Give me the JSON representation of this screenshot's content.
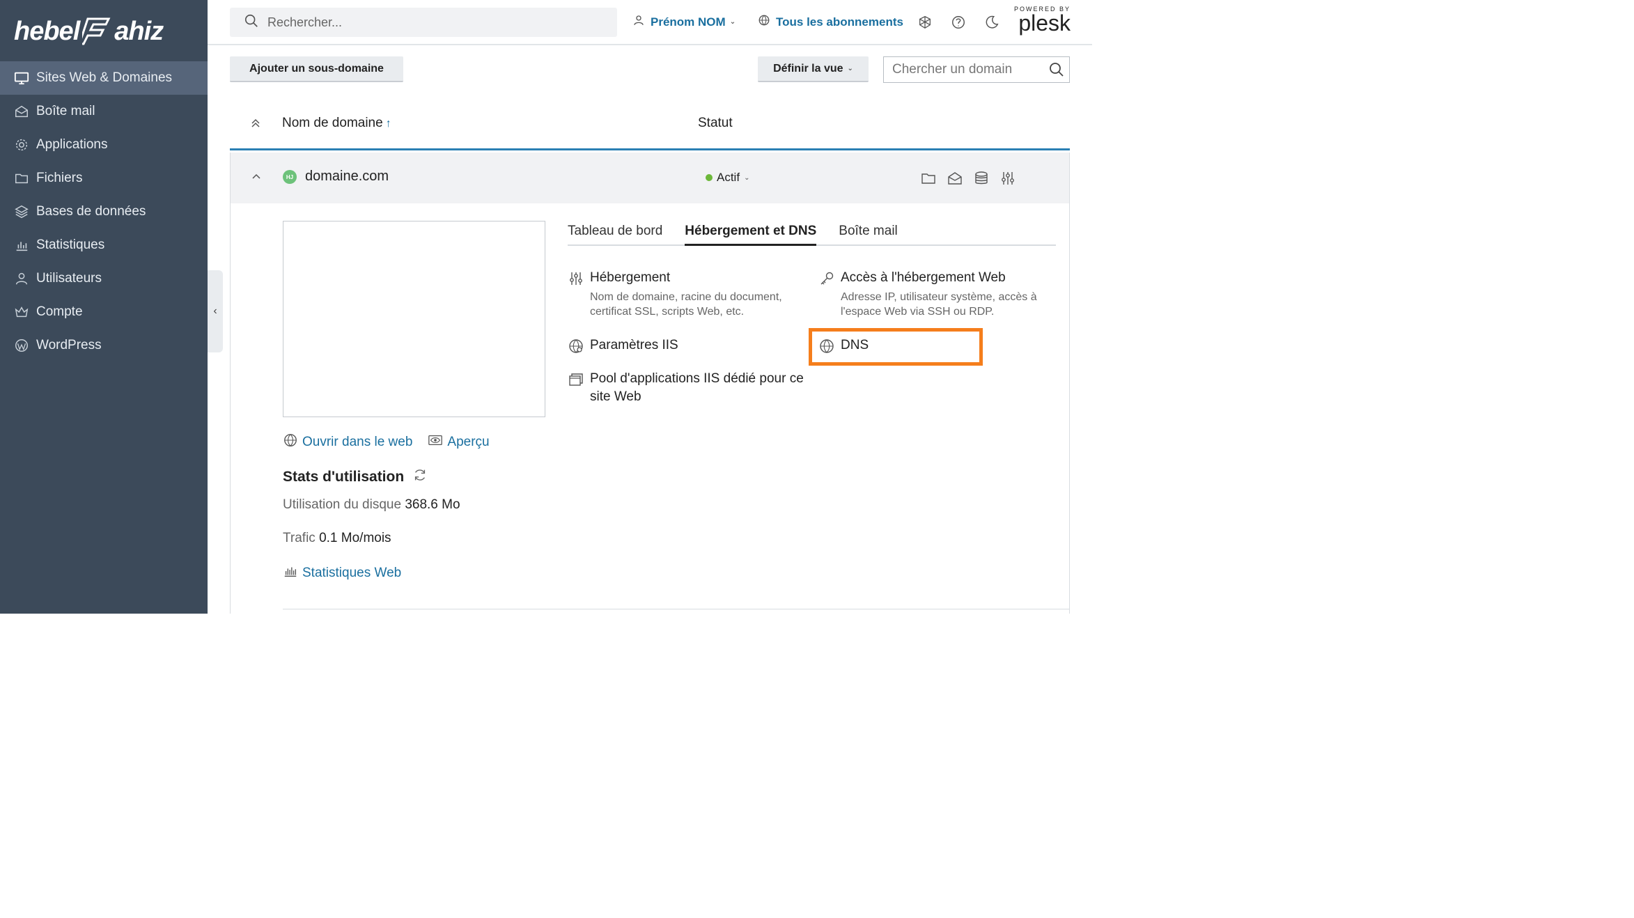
{
  "brand": {
    "logo_left": "hebel",
    "logo_right": "ahiz"
  },
  "sidebar": {
    "items": [
      {
        "label": "Sites Web & Domaines",
        "icon": "monitor-icon",
        "active": true
      },
      {
        "label": "Boîte mail",
        "icon": "mail-icon",
        "active": false
      },
      {
        "label": "Applications",
        "icon": "gear-icon",
        "active": false
      },
      {
        "label": "Fichiers",
        "icon": "folder-icon",
        "active": false
      },
      {
        "label": "Bases de données",
        "icon": "layers-icon",
        "active": false
      },
      {
        "label": "Statistiques",
        "icon": "bar-chart-icon",
        "active": false
      },
      {
        "label": "Utilisateurs",
        "icon": "user-icon",
        "active": false
      },
      {
        "label": "Compte",
        "icon": "crown-icon",
        "active": false
      },
      {
        "label": "WordPress",
        "icon": "wordpress-icon",
        "active": false
      }
    ],
    "collapse_glyph": "‹"
  },
  "header": {
    "search_placeholder": "Rechercher...",
    "user_label": "Prénom NOM",
    "subscriptions_label": "Tous les abonnements",
    "powered_by": "POWERED BY",
    "plesk": "plesk"
  },
  "toolbar": {
    "add_subdomain": "Ajouter un sous-domaine",
    "define_view": "Définir la vue",
    "domain_search_placeholder": "Chercher un domain"
  },
  "table": {
    "col_name": "Nom de domaine",
    "sort_arrow": "↑",
    "col_status": "Statut"
  },
  "domain": {
    "badge": "HJ",
    "name": "domaine.com",
    "status": "Actif",
    "status_color": "#6db83a",
    "tabs": [
      {
        "label": "Tableau de bord",
        "active": false
      },
      {
        "label": "Hébergement et DNS",
        "active": true
      },
      {
        "label": "Boîte mail",
        "active": false
      }
    ],
    "items": {
      "hosting": {
        "title": "Hébergement",
        "desc": "Nom de domaine, racine du document, certificat SSL, scripts Web, etc."
      },
      "web_access": {
        "title": "Accès à l'hébergement Web",
        "desc": "Adresse IP, utilisateur système, accès à l'espace Web via SSH ou RDP."
      },
      "iis": {
        "title": "Paramètres IIS"
      },
      "dns": {
        "title": "DNS"
      },
      "pool": {
        "title": "Pool d'applications IIS dédié pour ce site Web"
      }
    },
    "links": {
      "open_web": "Ouvrir dans le web",
      "preview": "Aperçu"
    },
    "stats": {
      "title": "Stats d'utilisation",
      "disk_label": "Utilisation du disque",
      "disk_value": "368.6 Mo",
      "traffic_label": "Trafic",
      "traffic_value": "0.1 Mo/mois",
      "web_stats": "Statistiques Web"
    }
  },
  "colors": {
    "sidebar_bg": "#3c4a5a",
    "accent": "#1a6f9f",
    "highlight": "#f57e1c"
  }
}
